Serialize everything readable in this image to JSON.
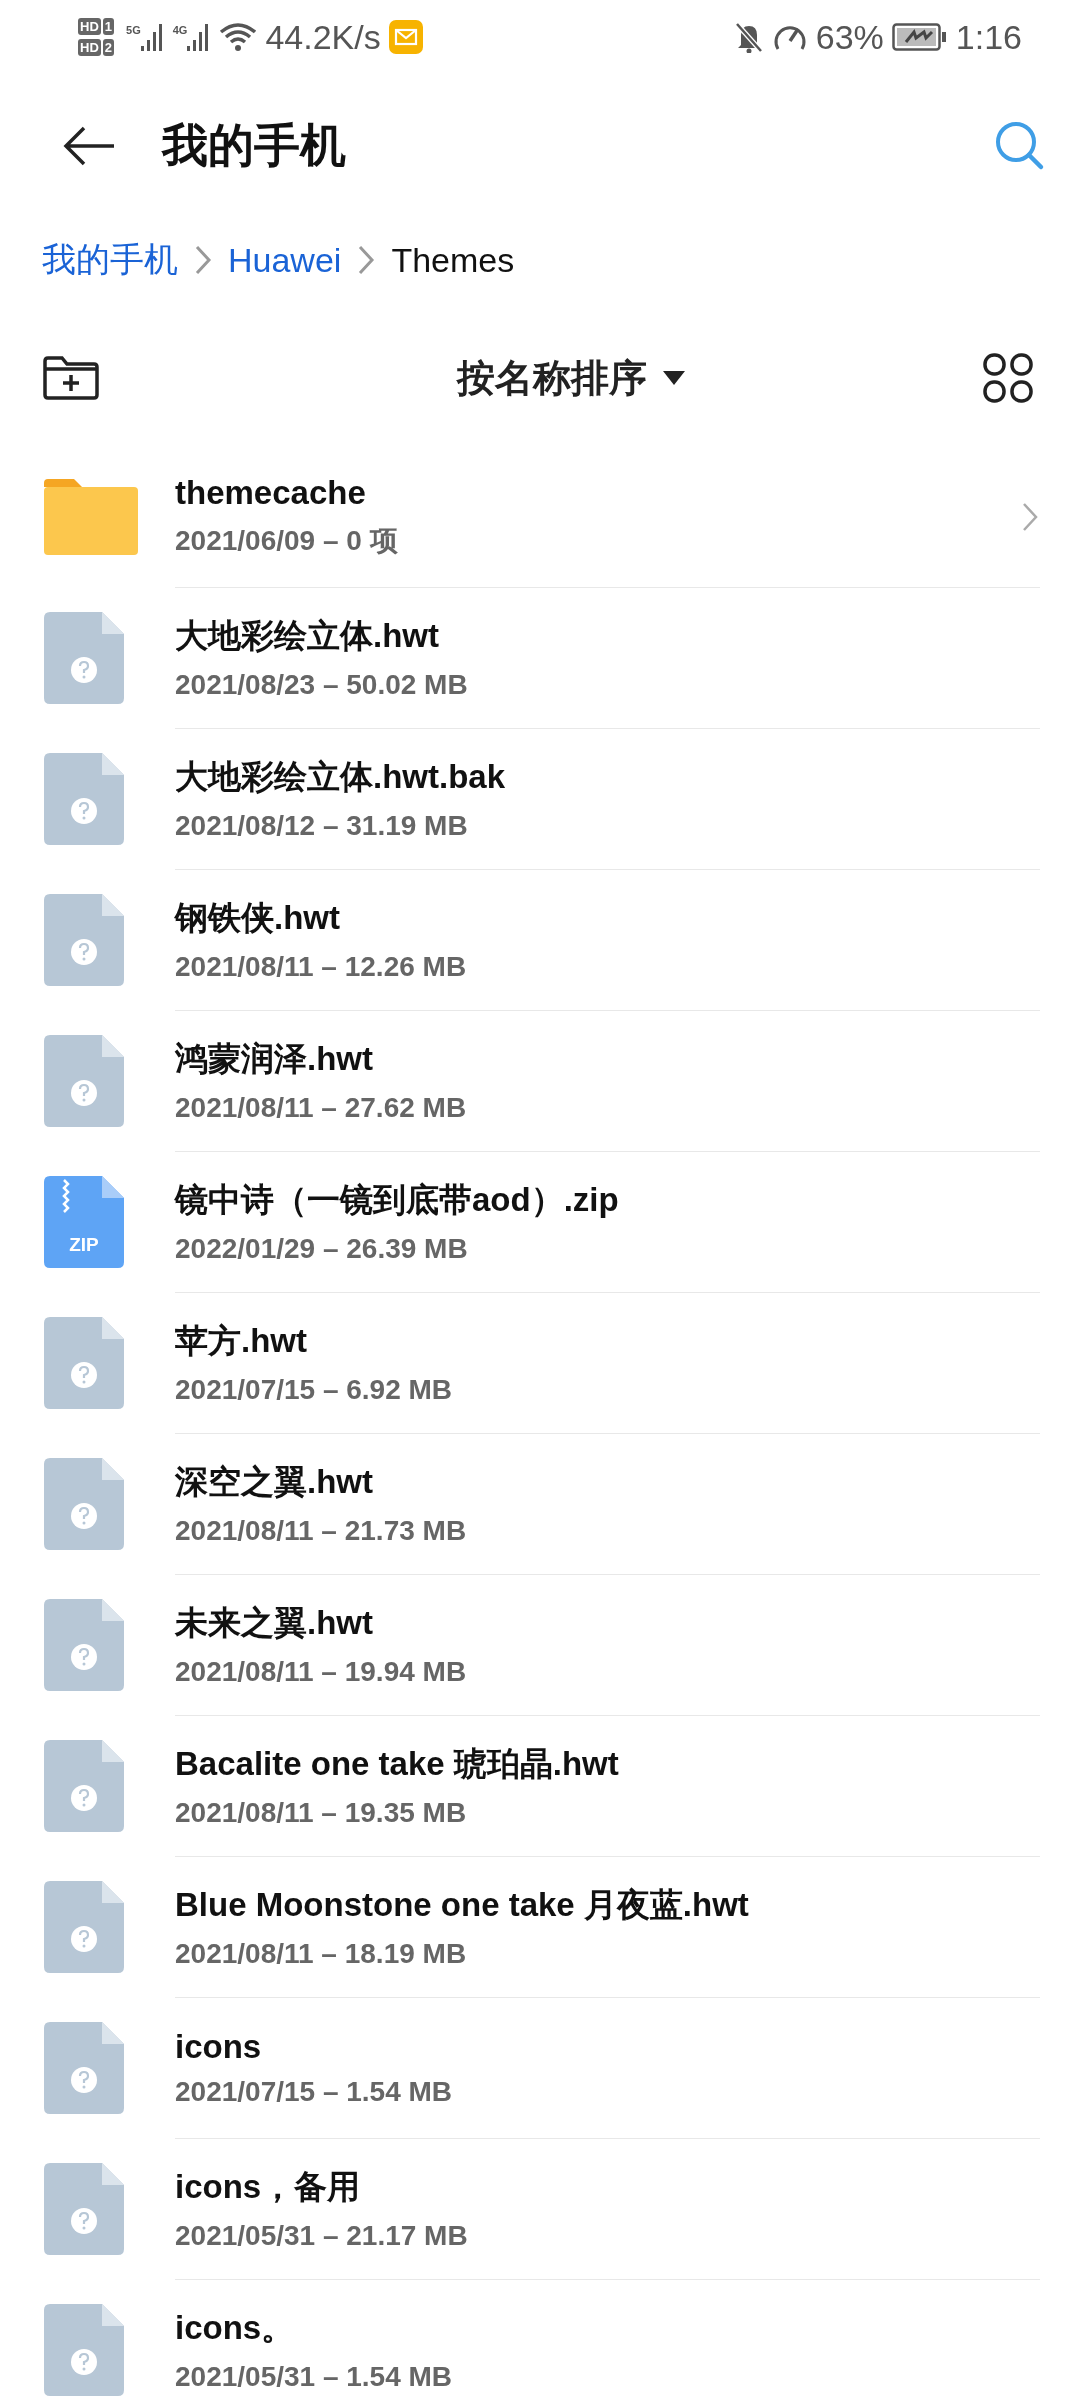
{
  "status_bar": {
    "sims": [
      {
        "label": "HD",
        "slot": "1"
      },
      {
        "label": "HD",
        "slot": "2"
      }
    ],
    "networks": [
      "5G",
      "4G"
    ],
    "speed": "44.2K/s",
    "battery": "63%",
    "time": "1:16"
  },
  "header": {
    "title": "我的手机"
  },
  "breadcrumb": [
    {
      "label": "我的手机",
      "current": false
    },
    {
      "label": "Huawei",
      "current": false
    },
    {
      "label": "Themes",
      "current": true
    }
  ],
  "toolbar": {
    "sort": "按名称排序"
  },
  "files": [
    {
      "kind": "folder",
      "name": "themecache",
      "meta": "2021/06/09 – 0 项"
    },
    {
      "kind": "file",
      "name": "大地彩绘立体.hwt",
      "meta": "2021/08/23 – 50.02 MB"
    },
    {
      "kind": "file",
      "name": "大地彩绘立体.hwt.bak",
      "meta": "2021/08/12 – 31.19 MB"
    },
    {
      "kind": "file",
      "name": "钢铁侠.hwt",
      "meta": "2021/08/11 – 12.26 MB"
    },
    {
      "kind": "file",
      "name": "鸿蒙润泽.hwt",
      "meta": "2021/08/11 – 27.62 MB"
    },
    {
      "kind": "zip",
      "name": "镜中诗（一镜到底带aod）.zip",
      "meta": "2022/01/29 – 26.39 MB",
      "icon_label": "ZIP"
    },
    {
      "kind": "file",
      "name": "苹方.hwt",
      "meta": "2021/07/15 – 6.92 MB"
    },
    {
      "kind": "file",
      "name": "深空之翼.hwt",
      "meta": "2021/08/11 – 21.73 MB"
    },
    {
      "kind": "file",
      "name": "未来之翼.hwt",
      "meta": "2021/08/11 – 19.94 MB"
    },
    {
      "kind": "file",
      "name": "Bacalite one take 琥珀晶.hwt",
      "meta": "2021/08/11 – 19.35 MB"
    },
    {
      "kind": "file",
      "name": "Blue Moonstone one take 月夜蓝.hwt",
      "meta": "2021/08/11 – 18.19 MB"
    },
    {
      "kind": "file",
      "name": "icons",
      "meta": "2021/07/15 – 1.54 MB"
    },
    {
      "kind": "file",
      "name": "icons，备用",
      "meta": "2021/05/31 – 21.17 MB"
    },
    {
      "kind": "file",
      "name": "icons。",
      "meta": "2021/05/31 – 1.54 MB"
    }
  ]
}
